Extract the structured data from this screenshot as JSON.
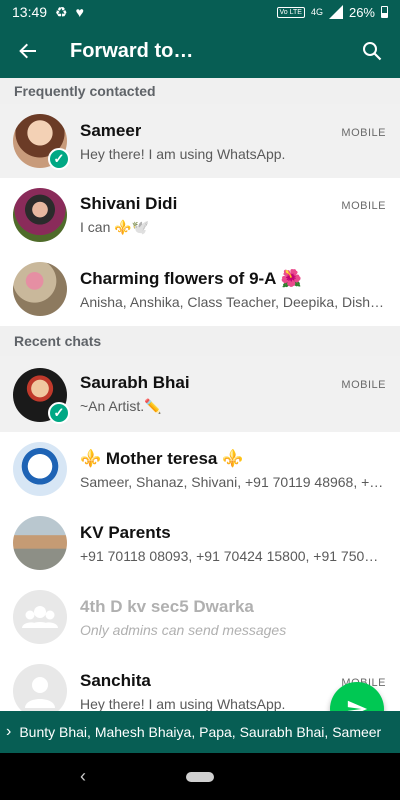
{
  "statusbar": {
    "time": "13:49",
    "volte": "Vo LTE",
    "network": "4G",
    "battery": "26%"
  },
  "appbar": {
    "title": "Forward to…",
    "back_icon": "arrow-back-icon",
    "search_icon": "search-icon"
  },
  "sections": {
    "frequent": "Frequently contacted",
    "recent": "Recent chats"
  },
  "contacts": [
    {
      "name": "Sameer",
      "sub": "Hey there! I am using WhatsApp.",
      "tag": "MOBILE",
      "selected": true
    },
    {
      "name": "Shivani Didi",
      "sub": "I can ⚜️🕊️",
      "tag": "MOBILE",
      "selected": false
    },
    {
      "name": "Charming flowers of 9-A 🌺",
      "sub": "Anisha, Anshika, Class Teacher, Deepika, Dish…",
      "tag": "",
      "selected": false
    },
    {
      "name": "Saurabh Bhai",
      "sub": "~An Artist.✏️",
      "tag": "MOBILE",
      "selected": true
    },
    {
      "name": "⚜️ Mother teresa ⚜️",
      "sub": "Sameer, Shanaz, Shivani, +91 70119 48968, +…",
      "tag": "",
      "selected": false
    },
    {
      "name": "KV Parents",
      "sub": "+91 70118 08093, +91 70424 15800, +91 750…",
      "tag": "",
      "selected": false
    },
    {
      "name": "4th D kv sec5 Dwarka",
      "sub": "Only admins can send messages",
      "tag": "",
      "selected": false
    },
    {
      "name": "Sanchita",
      "sub": "Hey there! I am using WhatsApp.",
      "tag": "MOBILE",
      "selected": false
    }
  ],
  "selected_bar": {
    "text": "Bunty Bhai, Mahesh Bhaiya, Papa, Saurabh Bhai, Sameer"
  },
  "colors": {
    "primary": "#075e54",
    "accent": "#00a884",
    "fab": "#00c853"
  }
}
